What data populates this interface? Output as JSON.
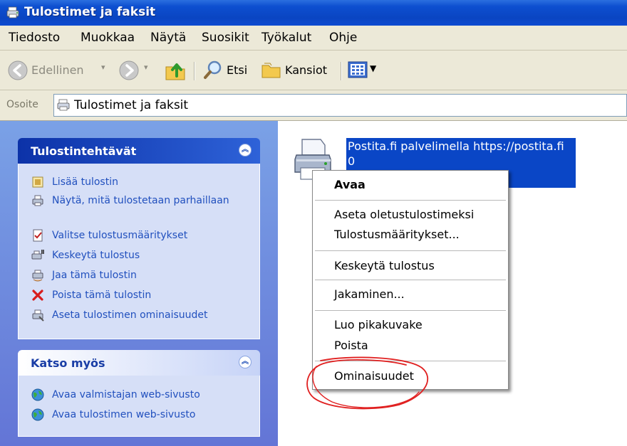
{
  "window": {
    "title": "Tulostimet ja faksit"
  },
  "menubar": {
    "items": [
      {
        "label": "Tiedosto"
      },
      {
        "label": "Muokkaa"
      },
      {
        "label": "Näytä"
      },
      {
        "label": "Suosikit"
      },
      {
        "label": "Työkalut"
      },
      {
        "label": "Ohje"
      }
    ]
  },
  "toolbar": {
    "back_label": "Edellinen",
    "search_label": "Etsi",
    "folders_label": "Kansiot"
  },
  "address": {
    "label": "Osoite",
    "value": "Tulostimet ja faksit"
  },
  "printer_tasks": {
    "title": "Tulostintehtävät",
    "items": [
      {
        "label": "Lisää tulostin",
        "icon": "add-printer-icon"
      },
      {
        "label": "Näytä, mitä tulostetaan parhaillaan",
        "icon": "print-queue-icon"
      },
      {
        "label": "Valitse tulostusmääritykset",
        "icon": "preferences-icon"
      },
      {
        "label": "Keskeytä tulostus",
        "icon": "pause-printer-icon"
      },
      {
        "label": "Jaa tämä tulostin",
        "icon": "share-printer-icon"
      },
      {
        "label": "Poista tämä tulostin",
        "icon": "delete-icon"
      },
      {
        "label": "Aseta tulostimen ominaisuudet",
        "icon": "printer-properties-icon"
      }
    ]
  },
  "see_also": {
    "title": "Katso myös",
    "items": [
      {
        "label": "Avaa valmistajan web-sivusto",
        "icon": "globe-icon"
      },
      {
        "label": "Avaa tulostimen web-sivusto",
        "icon": "globe-icon"
      }
    ]
  },
  "printer": {
    "name_line1": "Postita.fi palvelimella https://postita.fi",
    "name_line2": "0"
  },
  "context_menu": {
    "items": [
      {
        "label": "Avaa",
        "default": true
      },
      {
        "label": "Aseta oletustulostimeksi"
      },
      {
        "label": "Tulostusmääritykset..."
      },
      {
        "label": "Keskeytä tulostus"
      },
      {
        "label": "Jakaminen..."
      },
      {
        "label": "Luo pikakuvake"
      },
      {
        "label": "Poista"
      },
      {
        "label": "Ominaisuudet"
      }
    ]
  },
  "colors": {
    "titlebar": "#0a45c2",
    "selection": "#0a46c6",
    "task_link": "#2150be",
    "annotation": "#e02020"
  }
}
